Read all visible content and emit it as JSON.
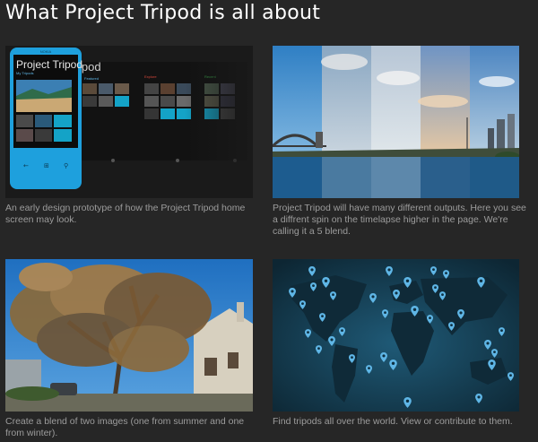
{
  "page": {
    "title": "What Project Tripod is all about"
  },
  "tiles": [
    {
      "caption": "An early design prototype of how the Project Tripod home screen may look.",
      "phone": {
        "brand": "NOKIA",
        "app_title": "Project Tripod",
        "section_my_tripods": "My Tripods",
        "section_featured": "Featured",
        "section_explore": "Explore",
        "section_recent": "Recent"
      }
    },
    {
      "caption": "Project Tripod will have many different outputs. Here you see a diffrent spin on the timelapse higher in the page. We're calling it a 5 blend."
    },
    {
      "caption": "Create a blend of two images (one from summer and one from winter)."
    },
    {
      "caption": "Find tripods all over the world. View or contribute to them."
    }
  ],
  "colors": {
    "background": "#262626",
    "phone_body": "#1ea0dd",
    "map_ocean": "#1b4d66",
    "map_pin": "#5fb6e6"
  }
}
